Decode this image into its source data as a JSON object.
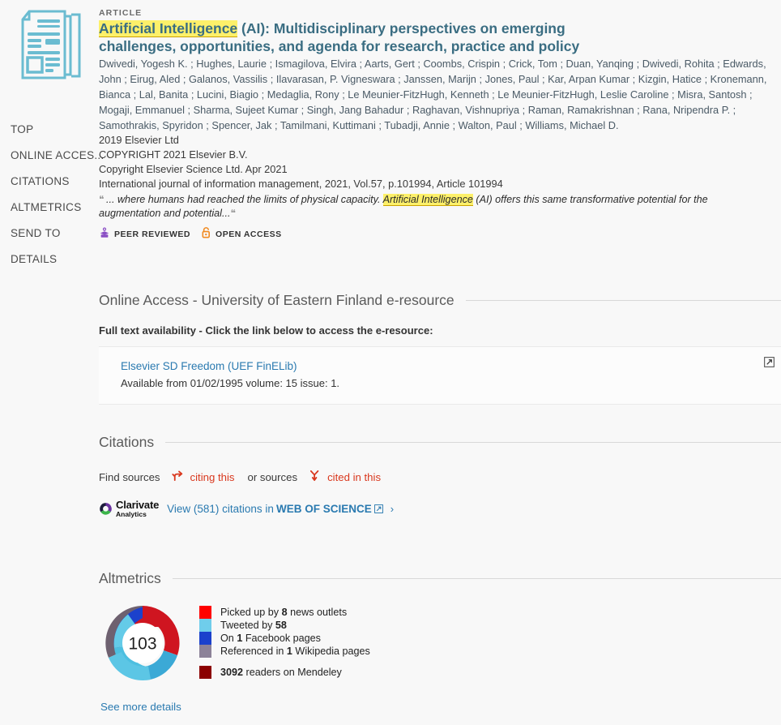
{
  "sidebar": {
    "items": [
      {
        "label": "TOP",
        "name": "sidebar-item-top"
      },
      {
        "label": "ONLINE ACCES...",
        "name": "sidebar-item-online-access"
      },
      {
        "label": "CITATIONS",
        "name": "sidebar-item-citations"
      },
      {
        "label": "ALTMETRICS",
        "name": "sidebar-item-altmetrics"
      },
      {
        "label": "SEND TO",
        "name": "sidebar-item-send-to"
      },
      {
        "label": "DETAILS",
        "name": "sidebar-item-details"
      }
    ]
  },
  "record": {
    "kicker": "ARTICLE",
    "title_highlight": "Artificial Intelligence",
    "title_rest": " (AI): Multidisciplinary perspectives on emerging challenges, opportunities, and agenda for research, practice and policy",
    "authors": "Dwivedi, Yogesh K. ; Hughes, Laurie ; Ismagilova, Elvira ; Aarts, Gert ; Coombs, Crispin ; Crick, Tom ; Duan, Yanqing ; Dwivedi, Rohita ; Edwards, John ; Eirug, Aled ; Galanos, Vassilis ; Ilavarasan, P. Vigneswara ; Janssen, Marijn ; Jones, Paul ; Kar, Arpan Kumar ; Kizgin, Hatice ; Kronemann, Bianca ; Lal, Banita ; Lucini, Biagio ; Medaglia, Rony ; Le Meunier-FitzHugh, Kenneth ; Le Meunier-FitzHugh, Leslie Caroline ; Misra, Santosh ; Mogaji, Emmanuel ; Sharma, Sujeet Kumar ; Singh, Jang Bahadur ; Raghavan, Vishnupriya ; Raman, Ramakrishnan ; Rana, Nripendra P. ; Samothrakis, Spyridon ; Spencer, Jak ; Tamilmani, Kuttimani ; Tubadji, Annie ; Walton, Paul ; Williams, Michael D.",
    "meta_lines": [
      "2019 Elsevier Ltd",
      "COPYRIGHT 2021 Elsevier B.V.",
      "Copyright Elsevier Science Ltd. Apr 2021",
      "International journal of information management, 2021, Vol.57, p.101994, Article 101994"
    ],
    "snippet_pre": "... where humans had reached the limits of physical capacity. ",
    "snippet_highlight": "Artificial Intelligence",
    "snippet_post": " (AI) offers this same transformative potential for the augmentation and potential...",
    "badges": [
      {
        "label": "PEER REVIEWED",
        "icon": "peer-reviewed-icon",
        "color": "#8a4fc4"
      },
      {
        "label": "OPEN ACCESS",
        "icon": "open-access-lock-icon",
        "color": "#f18a21"
      }
    ]
  },
  "online_access": {
    "section_title": "Online Access - University of Eastern Finland e-resource",
    "subhead": "Full text availability - Click the link below to access the e-resource:",
    "link_label": "Elsevier SD Freedom (UEF FinELib)",
    "availability": "Available from 01/02/1995 volume: 15 issue: 1."
  },
  "citations": {
    "section_title": "Citations",
    "find_sources_label": "Find sources",
    "citing_this_label": "citing this",
    "or_sources_label": "or sources",
    "cited_in_this_label": "cited in this",
    "clarivate_name": "Clarivate",
    "clarivate_sub": "Analytics",
    "wos_prefix": "View (581) citations in ",
    "wos_name": "WEB OF SCIENCE",
    "chevron": "›"
  },
  "altmetrics": {
    "section_title": "Altmetrics",
    "score": "103",
    "legend": [
      {
        "color": "#ff0000",
        "pre": "Picked up by ",
        "num": "8",
        "post": " news outlets",
        "name": "legend-news"
      },
      {
        "color": "#6fcdeb",
        "pre": "Tweeted by ",
        "num": "58",
        "post": "",
        "name": "legend-twitter"
      },
      {
        "color": "#1b41cc",
        "pre": "On ",
        "num": "1",
        "post": " Facebook pages",
        "name": "legend-facebook"
      },
      {
        "color": "#8c8298",
        "pre": "Referenced in ",
        "num": "1",
        "post": " Wikipedia pages",
        "name": "legend-wikipedia"
      }
    ],
    "mendeley": {
      "color": "#8b0000",
      "pre": "",
      "num": "3092",
      "post": " readers on Mendeley",
      "name": "legend-mendeley"
    },
    "see_more_label": "See more details"
  }
}
